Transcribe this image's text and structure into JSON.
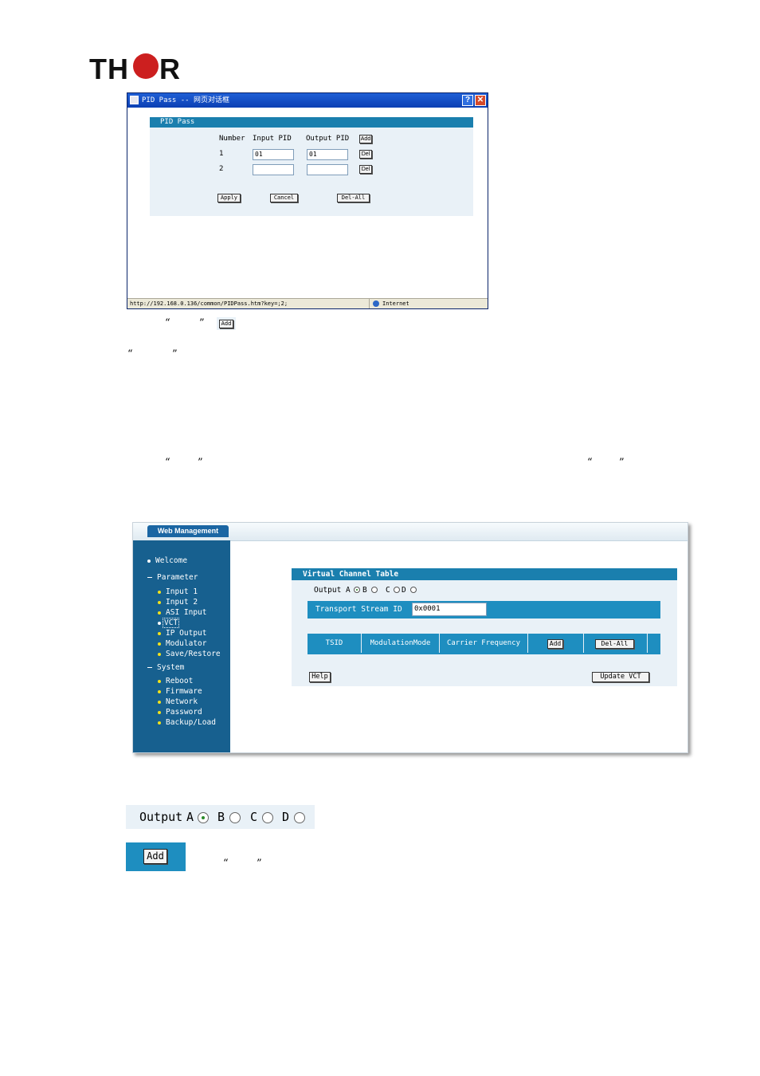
{
  "logo": {
    "text_left": "TH",
    "text_right": "R"
  },
  "pid_dialog": {
    "window_title": "PID Pass -- 网页对话框",
    "title_help": "?",
    "title_close": "✕",
    "panel_title": "PID Pass",
    "headers": {
      "number": "Number",
      "input_pid": "Input PID",
      "output_pid": "Output PID",
      "add": "Add"
    },
    "rows": [
      {
        "number": "1",
        "input": "01",
        "output": "01",
        "del": "Del"
      },
      {
        "number": "2",
        "input": "",
        "output": "",
        "del": "Del"
      }
    ],
    "buttons": {
      "apply": "Apply",
      "cancel": "Cancel",
      "del_all": "Del-All"
    },
    "status_url": "http://192.168.0.136/common/PIDPass.htm?key=;2;",
    "status_zone": "Internet"
  },
  "annotations": {
    "open_quote": "“",
    "close_quote": "”",
    "add_button": "Add"
  },
  "web_management": {
    "brand": "Web Management",
    "nav": {
      "welcome": "Welcome",
      "parameter": "Parameter",
      "input1": "Input 1",
      "input2": "Input 2",
      "asi_input": "ASI Input",
      "vct": "VCT",
      "ip_output": "IP Output",
      "modulator": "Modulator",
      "save_restore": "Save/Restore",
      "system": "System",
      "reboot": "Reboot",
      "firmware": "Firmware",
      "network": "Network",
      "password": "Password",
      "backup_load": "Backup/Load"
    },
    "vct": {
      "title": "Virtual Channel Table",
      "output_label": "Output",
      "options": [
        "A",
        "B",
        "C",
        "D"
      ],
      "selected": "A",
      "tsid_label": "Transport Stream ID",
      "tsid_value": "0x0001",
      "columns": [
        "TSID",
        "ModulationMode",
        "Carrier Frequency"
      ],
      "add": "Add",
      "del_all": "Del-All",
      "help": "Help",
      "update": "Update VCT"
    }
  },
  "zoom_output": {
    "label": "Output",
    "options": [
      "A",
      "B",
      "C",
      "D"
    ],
    "selected": "A"
  },
  "zoom_add": {
    "label": "Add"
  }
}
